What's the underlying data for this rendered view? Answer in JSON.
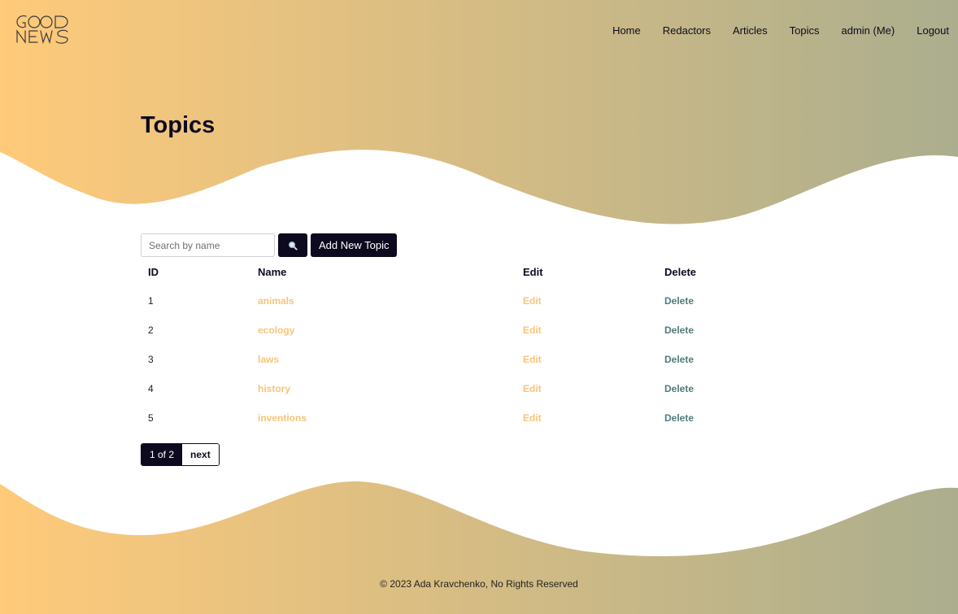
{
  "header": {
    "logo_text": "GOOD NEWS",
    "nav": [
      {
        "label": "Home"
      },
      {
        "label": "Redactors"
      },
      {
        "label": "Articles"
      },
      {
        "label": "Topics"
      },
      {
        "label": "admin (Me)"
      },
      {
        "label": "Logout"
      }
    ]
  },
  "page": {
    "title": "Topics"
  },
  "toolbar": {
    "search_placeholder": "Search by name",
    "search_icon": "search-icon",
    "add_label": "Add New Topic"
  },
  "table": {
    "columns": [
      "ID",
      "Name",
      "Edit",
      "Delete"
    ],
    "rows": [
      {
        "id": "1",
        "name": "animals",
        "edit": "Edit",
        "delete": "Delete"
      },
      {
        "id": "2",
        "name": "ecology",
        "edit": "Edit",
        "delete": "Delete"
      },
      {
        "id": "3",
        "name": "laws",
        "edit": "Edit",
        "delete": "Delete"
      },
      {
        "id": "4",
        "name": "history",
        "edit": "Edit",
        "delete": "Delete"
      },
      {
        "id": "5",
        "name": "inventions",
        "edit": "Edit",
        "delete": "Delete"
      }
    ]
  },
  "pagination": {
    "current": "1 of 2",
    "next": "next"
  },
  "footer": {
    "text": "© 2023 Ada Kravchenko, No Rights Reserved"
  },
  "colors": {
    "gradient_start": "#ffca7a",
    "gradient_end": "#abae8e",
    "primary_dark": "#0d0a1f",
    "link_orange": "#f7c47b",
    "link_teal": "#4e7c7a"
  }
}
